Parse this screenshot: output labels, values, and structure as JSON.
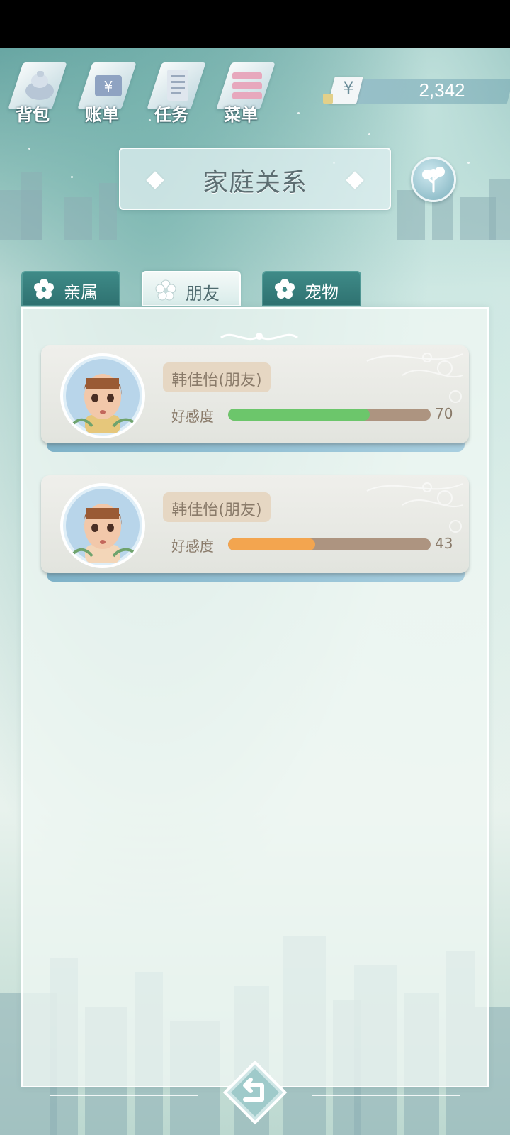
{
  "top_menu": {
    "items": [
      {
        "label": "背包",
        "icon": "bag-icon"
      },
      {
        "label": "账单",
        "icon": "bill-icon"
      },
      {
        "label": "任务",
        "icon": "task-icon"
      },
      {
        "label": "菜单",
        "icon": "menu-icon"
      }
    ]
  },
  "money": {
    "currency_symbol": "¥",
    "amount": "2,342"
  },
  "header": {
    "title": "家庭关系"
  },
  "tabs": [
    {
      "label": "亲属",
      "active": false
    },
    {
      "label": "朋友",
      "active": true
    },
    {
      "label": "宠物",
      "active": false
    }
  ],
  "relationships": [
    {
      "name": "韩佳怡(朋友)",
      "affection_label": "好感度",
      "affection": 70,
      "max": 100,
      "bar_color": "#6cc66b"
    },
    {
      "name": "韩佳怡(朋友)",
      "affection_label": "好感度",
      "affection": 43,
      "max": 100,
      "bar_color": "#f3a54f"
    }
  ]
}
